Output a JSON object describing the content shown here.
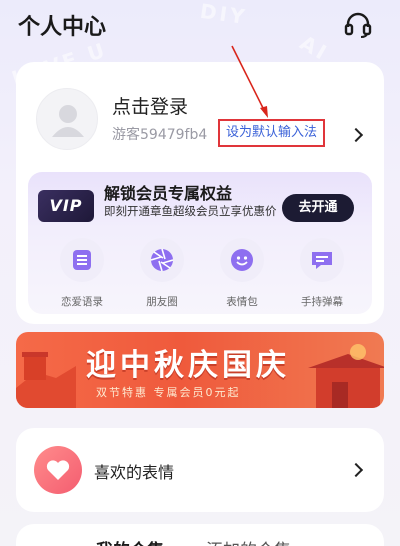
{
  "header": {
    "title": "个人中心",
    "headset_icon": "headset-icon",
    "bg_text": [
      "LOVE U",
      "DIY",
      "AI"
    ]
  },
  "login": {
    "title": "点击登录",
    "guest_id": "游客59479fb4",
    "default_ime": "设为默认输入法",
    "avatar_icon": "avatar-icon"
  },
  "vip": {
    "badge": "VIP",
    "title": "解锁会员专属权益",
    "desc": "即刻开通章鱼超级会员立享优惠价",
    "button": "去开通",
    "features": [
      {
        "label": "恋爱语录",
        "icon": "text-list-icon"
      },
      {
        "label": "朋友圈",
        "icon": "aperture-icon"
      },
      {
        "label": "表情包",
        "icon": "smiley-icon"
      },
      {
        "label": "手持弹幕",
        "icon": "message-icon"
      }
    ]
  },
  "banner": {
    "title": "迎中秋庆国庆",
    "subtitle": "双节特惠  专属会员0元起"
  },
  "favorites": {
    "label": "喜欢的表情",
    "icon": "heart-icon"
  },
  "tabs": [
    {
      "label": "我的合集"
    },
    {
      "label": "添加的合集"
    }
  ],
  "colors": {
    "accent_red": "#e0353a",
    "link_blue": "#3a61d8",
    "vip_button": "#1c1b33",
    "banner_orange": "#ef5a3c"
  }
}
